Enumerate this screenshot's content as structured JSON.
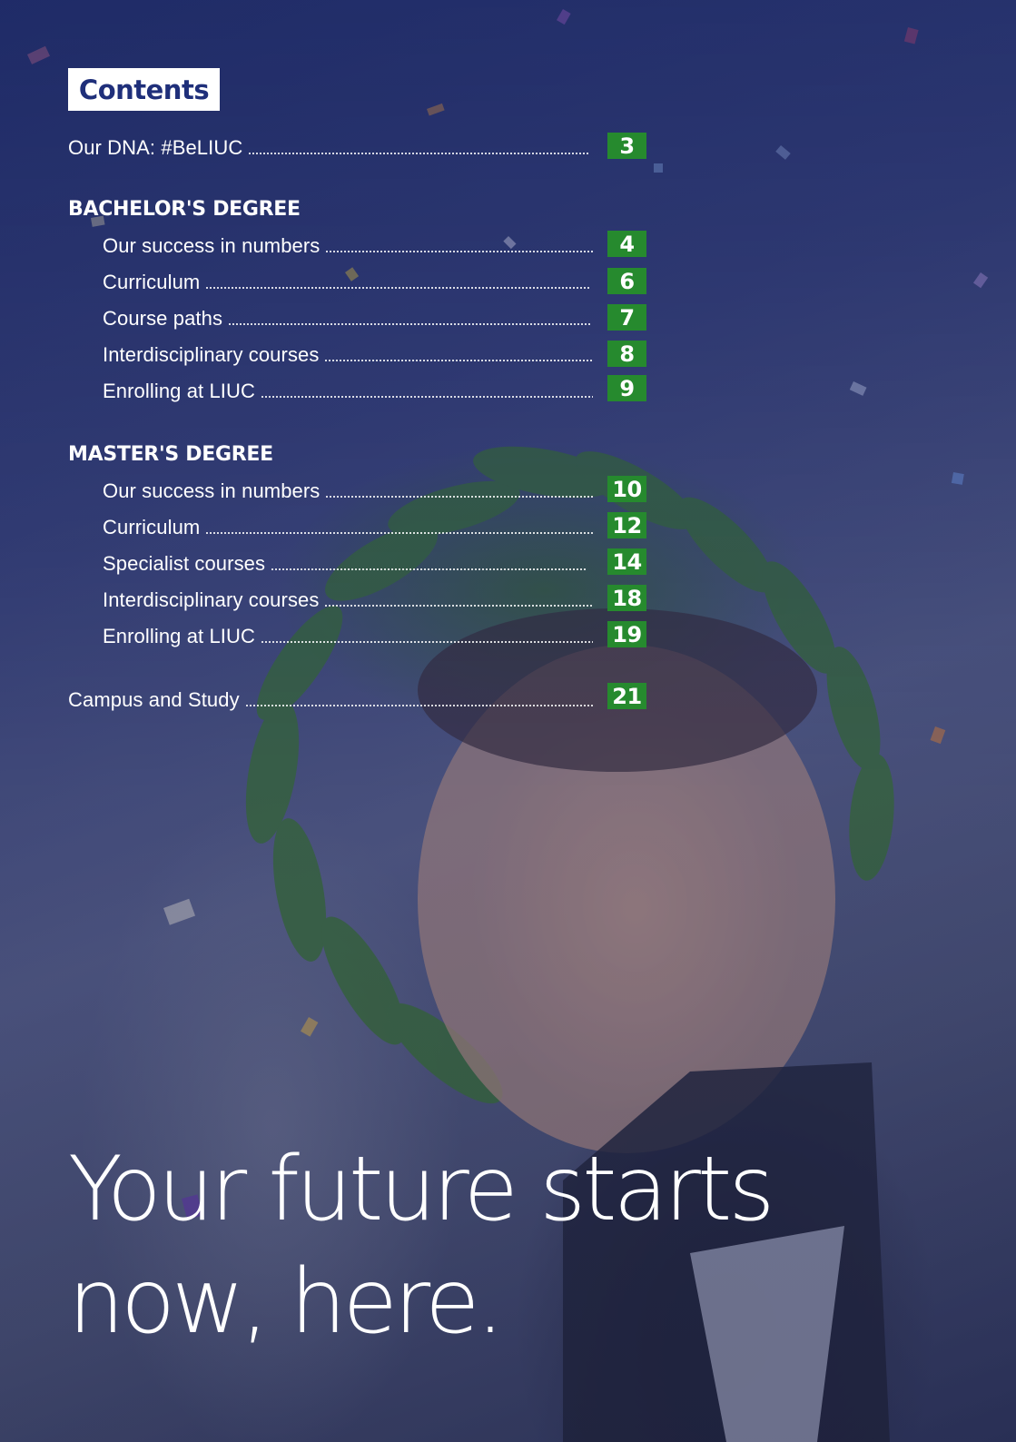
{
  "contents_title": "Contents",
  "intro": {
    "label": "Our DNA: #BeLIUC",
    "page": "3"
  },
  "bachelor": {
    "heading": "BACHELOR'S DEGREE",
    "items": [
      {
        "label": "Our success in numbers",
        "page": "4"
      },
      {
        "label": "Curriculum",
        "page": "6"
      },
      {
        "label": "Course paths",
        "page": "7"
      },
      {
        "label": "Interdisciplinary courses",
        "page": "8"
      },
      {
        "label": "Enrolling at LIUC",
        "page": "9"
      }
    ]
  },
  "master": {
    "heading": "MASTER'S DEGREE",
    "items": [
      {
        "label": "Our success in numbers",
        "page": "10"
      },
      {
        "label": "Curriculum",
        "page": "12"
      },
      {
        "label": "Specialist courses",
        "page": "14"
      },
      {
        "label": "Interdisciplinary courses",
        "page": "18"
      },
      {
        "label": "Enrolling at LIUC",
        "page": "19"
      }
    ]
  },
  "campus": {
    "label": "Campus and Study",
    "page": "21"
  },
  "tagline": {
    "line1": "Your future starts",
    "line2": "now, here."
  },
  "colors": {
    "brand_blue": "#1f2f7a",
    "page_badge_green": "#268a2e",
    "overlay_blue": "#1c2869"
  }
}
